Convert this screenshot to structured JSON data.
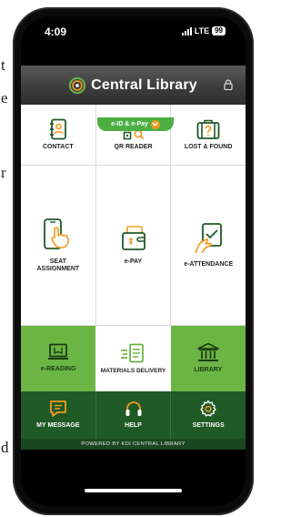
{
  "background": {
    "letters": [
      "t",
      "e",
      "r",
      "d"
    ]
  },
  "status_bar": {
    "time": "4:09",
    "network": "LTE",
    "battery": "99"
  },
  "header": {
    "title": "Central Library",
    "logo_icon": "library-logo-icon",
    "lock_icon": "lock-icon"
  },
  "badge": {
    "label": "e-ID & e-Pay",
    "icon": "chevron-down-icon"
  },
  "tiles": {
    "contact": {
      "label": "CONTACT",
      "icon": "contact-book-icon"
    },
    "qr_reader": {
      "label": "QR READER",
      "icon": "qr-code-icon"
    },
    "lost_found": {
      "label": "LOST & FOUND",
      "icon": "luggage-question-icon"
    },
    "seat_assignment": {
      "label": "SEAT ASSIGNMENT",
      "icon": "phone-tap-icon"
    },
    "e_pay": {
      "label": "e-PAY",
      "icon": "wallet-icon"
    },
    "e_attendance": {
      "label": "e-ATTENDANCE",
      "icon": "hand-check-icon"
    },
    "e_reading": {
      "label": "e-READING",
      "icon": "ebook-screen-icon"
    },
    "materials_delivery": {
      "label": "MATERIALS DELIVERY",
      "icon": "document-delivery-icon"
    },
    "library": {
      "label": "LIBRARY",
      "icon": "library-building-icon"
    },
    "my_message": {
      "label": "MY MESSAGE",
      "icon": "message-icon"
    },
    "help": {
      "label": "HELP",
      "icon": "headphones-icon"
    },
    "settings": {
      "label": "SETTINGS",
      "icon": "gear-icon"
    }
  },
  "footer": {
    "text": "POWERED BY KDI CENTRAL LIBRARY"
  },
  "colors": {
    "accent_green": "#6bb545",
    "dark_green": "#1f5a27",
    "orange": "#f39a1e"
  }
}
